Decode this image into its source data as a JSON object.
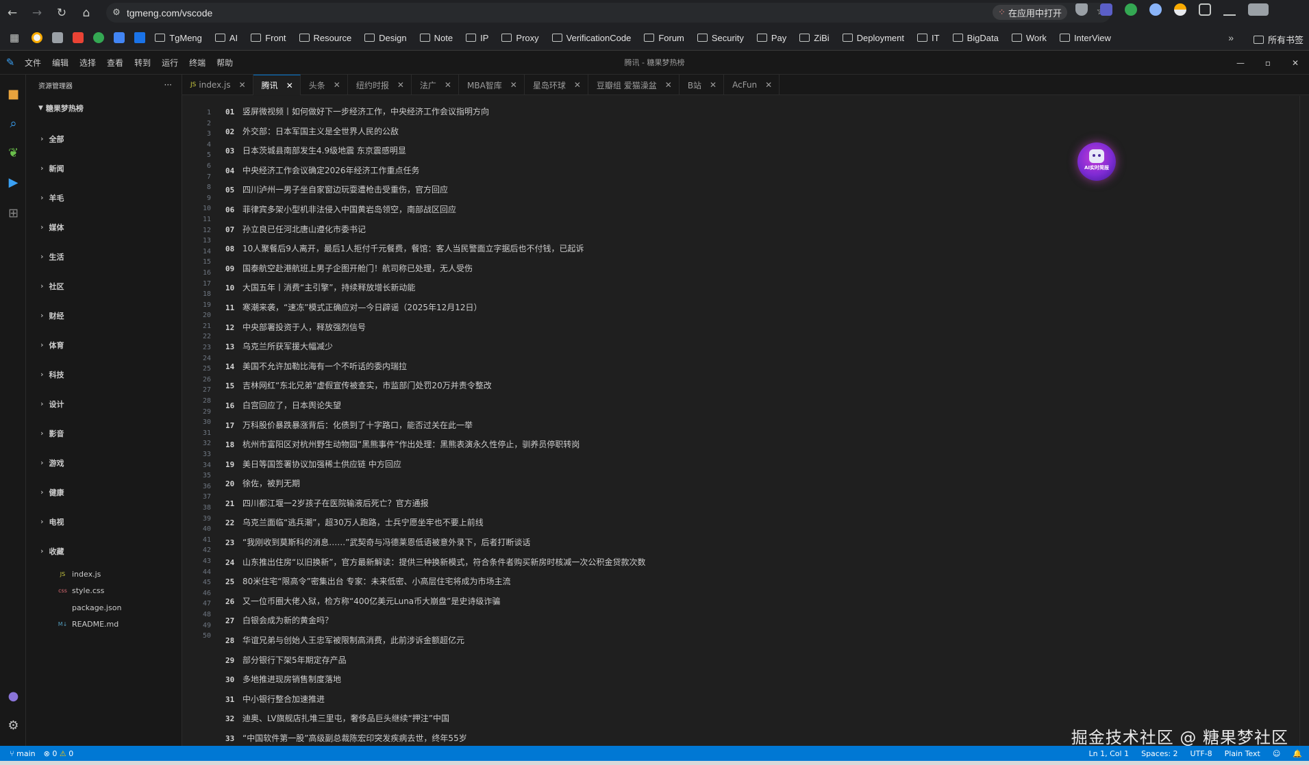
{
  "browser": {
    "url": "tgmeng.com/vscode",
    "open_in_app": "在应用中打开",
    "bookmarks": [
      "TgMeng",
      "AI",
      "Front",
      "Resource",
      "Design",
      "Note",
      "IP",
      "Proxy",
      "VerificationCode",
      "Forum",
      "Security",
      "Pay",
      "ZiBi",
      "Deployment",
      "IT",
      "BigData",
      "Work",
      "InterView"
    ],
    "all_bookmarks": "所有书签"
  },
  "vscode": {
    "menu": [
      "文件",
      "编辑",
      "选择",
      "查看",
      "转到",
      "运行",
      "终端",
      "帮助"
    ],
    "window_title": "腾讯 - 糖果梦热榜",
    "explorer_title": "资源管理器",
    "root_folder": "糖果梦热榜",
    "folders": [
      "全部",
      "新闻",
      "羊毛",
      "媒体",
      "生活",
      "社区",
      "财经",
      "体育",
      "科技",
      "设计",
      "影音",
      "游戏",
      "健康",
      "电视",
      "收藏"
    ],
    "files": [
      {
        "name": "index.js",
        "tag": "JS"
      },
      {
        "name": "style.css",
        "tag": "css"
      },
      {
        "name": "package.json",
        "tag": ""
      },
      {
        "name": "README.md",
        "tag": "M↓"
      }
    ],
    "tabs": [
      {
        "label": "index.js",
        "tag": "JS",
        "active": false
      },
      {
        "label": "腾讯",
        "active": true
      },
      {
        "label": "头条",
        "active": false
      },
      {
        "label": "纽约时报",
        "active": false
      },
      {
        "label": "法广",
        "active": false
      },
      {
        "label": "MBA智库",
        "active": false
      },
      {
        "label": "星岛环球",
        "active": false
      },
      {
        "label": "豆瓣组 爱猫澡盆",
        "active": false
      },
      {
        "label": "B站",
        "active": false
      },
      {
        "label": "AcFun",
        "active": false
      }
    ],
    "line_numbers_count": 50,
    "news": [
      "竖屏微视频丨如何做好下一步经济工作，中央经济工作会议指明方向",
      "外交部：日本军国主义是全世界人民的公敌",
      "日本茨城县南部发生4.9级地震 东京震感明显",
      "中央经济工作会议确定2026年经济工作重点任务",
      "四川泸州一男子坐自家窗边玩耍遭枪击受重伤，官方回应",
      "菲律宾多架小型机非法侵入中国黄岩岛领空，南部战区回应",
      "孙立良已任河北唐山遵化市委书记",
      "10人聚餐后9人离开，最后1人拒付千元餐费，餐馆：客人当民警面立字据后也不付钱，已起诉",
      "国泰航空赴港航班上男子企图开舱门！航司称已处理，无人受伤",
      "大国五年丨消费“主引擎”，持续释放增长新动能",
      "寒潮来袭，“速冻”模式正确应对—今日辟谣（2025年12月12日）",
      "中央部署投资于人，释放强烈信号",
      "乌克兰所获军援大幅减少",
      "美国不允许加勒比海有一个不听话的委内瑞拉",
      "吉林网红“东北兄弟”虚假宣传被查实，市监部门处罚20万并责令整改",
      "白宫回应了，日本舆论失望",
      "万科股价暴跌暴涨背后：化债到了十字路口，能否过关在此一举",
      "杭州市富阳区对杭州野生动物园“黑熊事件”作出处理：黑熊表演永久性停止，驯养员停职转岗",
      "美日等国签署协议加强稀土供应链 中方回应",
      "徐佐，被判无期",
      "四川都江堰一2岁孩子在医院输液后死亡？官方通报",
      "乌克兰面临“逃兵潮”，超30万人跑路，士兵宁愿坐牢也不要上前线",
      "“我刚收到莫斯科的消息……”武契奇与冯德莱恩低语被意外录下，后者打断谈话",
      "山东推出住房“以旧换新”，官方最新解读：提供三种换新模式，符合条件者购买新房时核减一次公积金贷款次数",
      "80米住宅“限高令”密集出台 专家：未来低密、小高层住宅将成为市场主流",
      "又一位币圈大佬入狱，检方称“400亿美元Luna币大崩盘”是史诗级诈骗",
      "白银会成为新的黄金吗？",
      "华谊兄弟与创始人王忠军被限制高消费，此前涉诉金额超亿元",
      "部分银行下架5年期定存产品",
      "多地推进现房销售制度落地",
      "中小银行整合加速推进",
      "迪奥、LV旗舰店扎堆三里屯，奢侈品巨头继续“押注”中国",
      "“中国软件第一股”高级副总裁陈宏印突发疾病去世，终年55岁"
    ],
    "ai_badge": "AI实时简报",
    "watermark": "掘金技术社区 @ 糖果梦社区",
    "status": {
      "branch": "main",
      "errors": "0",
      "warnings": "0",
      "position": "Ln 1, Col 1",
      "spaces": "Spaces: 2",
      "encoding": "UTF-8",
      "language": "Plain Text"
    }
  },
  "colors": {
    "status_bar": "#0078d4",
    "tab_active_border": "#0078d4",
    "editor_bg": "#1f1f1f",
    "sidebar_bg": "#181818"
  }
}
